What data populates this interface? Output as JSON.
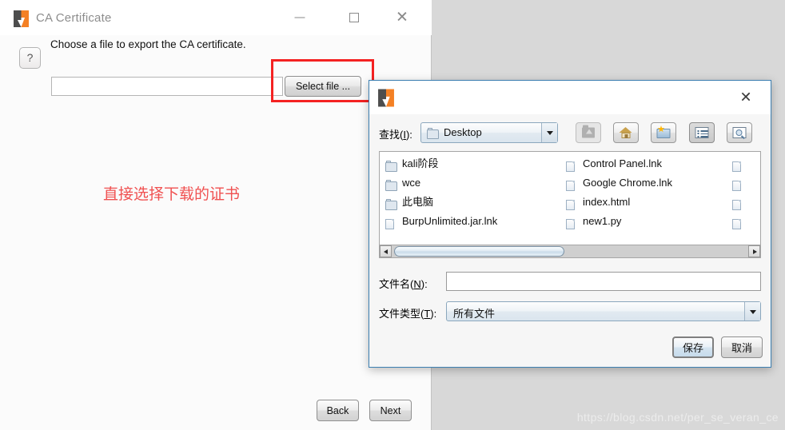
{
  "ca_window": {
    "title": "CA Certificate",
    "logo_icon": "burp-suite-logo-icon",
    "minimize_label": "",
    "maximize_label": "",
    "close_label": "✕",
    "help_icon_label": "?",
    "instruction": "Choose a file to export the CA certificate.",
    "path_value": "",
    "select_file_label": "Select file ...",
    "annotation": "直接选择下载的证书",
    "annotation_color": "#f05050",
    "highlight_color": "#f42222",
    "back_label": "Back",
    "next_label": "Next"
  },
  "file_dialog": {
    "logo_icon": "burp-suite-logo-icon",
    "close_label": "✕",
    "look_in_label_pre": "查找(",
    "look_in_label_key": "I",
    "look_in_label_post": "):",
    "look_in_value": "Desktop",
    "toolbar": [
      {
        "name": "up-one-level",
        "icon": "up-folder-icon",
        "state": "disabled"
      },
      {
        "name": "home",
        "icon": "home-icon",
        "state": "normal"
      },
      {
        "name": "create-new-folder",
        "icon": "new-folder-icon",
        "state": "normal"
      },
      {
        "name": "list-view",
        "icon": "list-view-icon",
        "state": "selected"
      },
      {
        "name": "details-view",
        "icon": "details-view-icon",
        "state": "normal"
      }
    ],
    "files": {
      "column1": [
        {
          "name": "kali阶段",
          "type": "folder"
        },
        {
          "name": "wce",
          "type": "folder"
        },
        {
          "name": "此电脑",
          "type": "folder"
        },
        {
          "name": "BurpUnlimited.jar.lnk",
          "type": "file"
        }
      ],
      "column2": [
        {
          "name": "Control Panel.lnk",
          "type": "file"
        },
        {
          "name": "Google Chrome.lnk",
          "type": "file"
        },
        {
          "name": "index.html",
          "type": "file"
        },
        {
          "name": "new1.py",
          "type": "file"
        }
      ],
      "column3": [
        {
          "name": "",
          "type": "file"
        },
        {
          "name": "",
          "type": "file"
        },
        {
          "name": "",
          "type": "file"
        },
        {
          "name": "",
          "type": "file"
        }
      ]
    },
    "filename_label_pre": "文件名(",
    "filename_label_key": "N",
    "filename_label_post": "):",
    "filename_value": "",
    "filetype_label_pre": "文件类型(",
    "filetype_label_key": "T",
    "filetype_label_post": "):",
    "filetype_value": "所有文件",
    "save_label": "保存",
    "cancel_label": "取消"
  },
  "watermark": "https://blog.csdn.net/per_se_veran_ce"
}
